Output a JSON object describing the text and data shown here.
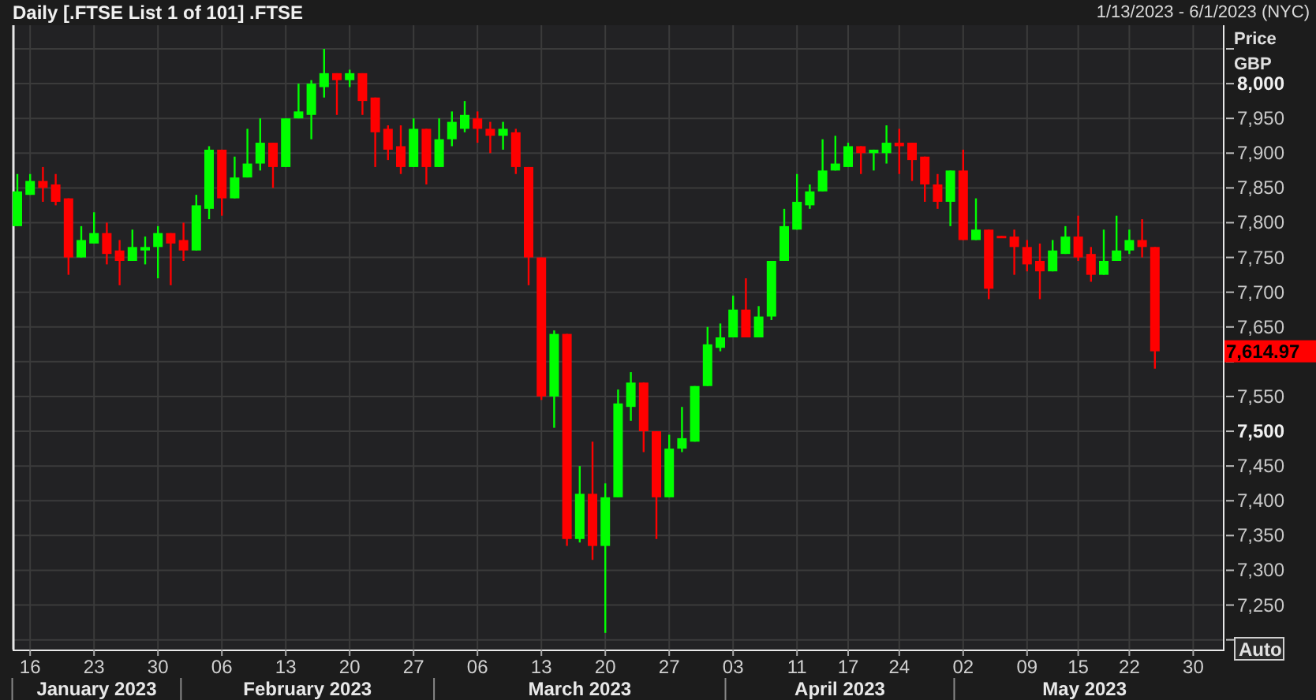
{
  "header": {
    "title": "Daily [.FTSE List 1 of 101] .FTSE",
    "date_range": "1/13/2023 - 6/1/2023 (NYC)"
  },
  "chart": {
    "currency": "GBP",
    "auto_button": "Auto",
    "months": [
      "January 2023",
      "February 2023",
      "March 2023",
      "April 2023",
      "May 2023"
    ],
    "chart_data": {
      "type": "candlestick",
      "grid": true,
      "ylabel": "Price",
      "ylim": [
        7186,
        8084
      ],
      "categories": [
        null,
        "16",
        null,
        null,
        null,
        null,
        "23",
        null,
        null,
        null,
        null,
        "30",
        null,
        null,
        null,
        null,
        "06",
        null,
        null,
        null,
        null,
        "13",
        null,
        null,
        null,
        null,
        "20",
        null,
        null,
        null,
        null,
        "27",
        null,
        null,
        null,
        null,
        "06",
        null,
        null,
        null,
        null,
        "13",
        null,
        null,
        null,
        null,
        "20",
        null,
        null,
        null,
        null,
        "27",
        null,
        null,
        null,
        null,
        "03",
        null,
        null,
        null,
        null,
        "11",
        null,
        null,
        null,
        "17",
        null,
        null,
        null,
        "24",
        null,
        null,
        null,
        null,
        "02",
        null,
        null,
        null,
        null,
        "09",
        null,
        null,
        null,
        "15",
        null,
        null,
        null,
        "22",
        null,
        null,
        null,
        null,
        "30"
      ],
      "yticks": [
        {
          "value": 8000,
          "label": "8,000"
        },
        {
          "value": 7950,
          "label": "7,950"
        },
        {
          "value": 7900,
          "label": "7,900"
        },
        {
          "value": 7850,
          "label": "7,850"
        },
        {
          "value": 7800,
          "label": "7,800"
        },
        {
          "value": 7750,
          "label": "7,750"
        },
        {
          "value": 7700,
          "label": "7,700"
        },
        {
          "value": 7650,
          "label": "7,650"
        },
        {
          "value": 7550,
          "label": "7,550"
        },
        {
          "value": 7500,
          "label": "7,500"
        },
        {
          "value": 7450,
          "label": "7,450"
        },
        {
          "value": 7400,
          "label": "7,400"
        },
        {
          "value": 7350,
          "label": "7,350"
        },
        {
          "value": 7300,
          "label": "7,300"
        },
        {
          "value": 7250,
          "label": "7,250"
        }
      ],
      "annotations": [
        "7,614.97"
      ],
      "ohlc": [
        [
          7795,
          7870,
          7795,
          7845
        ],
        [
          7840,
          7870,
          7840,
          7860
        ],
        [
          7860,
          7880,
          7830,
          7850
        ],
        [
          7855,
          7870,
          7825,
          7830
        ],
        [
          7835,
          7835,
          7725,
          7750
        ],
        [
          7750,
          7795,
          7750,
          7775
        ],
        [
          7770,
          7815,
          7770,
          7785
        ],
        [
          7785,
          7800,
          7740,
          7755
        ],
        [
          7760,
          7775,
          7710,
          7745
        ],
        [
          7745,
          7790,
          7745,
          7765
        ],
        [
          7760,
          7780,
          7740,
          7765
        ],
        [
          7765,
          7795,
          7720,
          7785
        ],
        [
          7785,
          7785,
          7710,
          7770
        ],
        [
          7775,
          7800,
          7745,
          7760
        ],
        [
          7760,
          7840,
          7760,
          7825
        ],
        [
          7820,
          7910,
          7805,
          7905
        ],
        [
          7905,
          7905,
          7810,
          7835
        ],
        [
          7835,
          7895,
          7835,
          7865
        ],
        [
          7865,
          7935,
          7865,
          7885
        ],
        [
          7885,
          7950,
          7875,
          7915
        ],
        [
          7915,
          7915,
          7850,
          7880
        ],
        [
          7880,
          7950,
          7880,
          7950
        ],
        [
          7950,
          8000,
          7950,
          7960
        ],
        [
          7955,
          8005,
          7920,
          8000
        ],
        [
          7995,
          8050,
          7980,
          8015
        ],
        [
          8015,
          8015,
          7955,
          8005
        ],
        [
          8005,
          8020,
          7995,
          8015
        ],
        [
          8015,
          8015,
          7955,
          7975
        ],
        [
          7980,
          7980,
          7880,
          7930
        ],
        [
          7935,
          7940,
          7890,
          7905
        ],
        [
          7910,
          7940,
          7870,
          7880
        ],
        [
          7880,
          7950,
          7880,
          7935
        ],
        [
          7935,
          7935,
          7855,
          7880
        ],
        [
          7880,
          7950,
          7880,
          7920
        ],
        [
          7920,
          7960,
          7910,
          7945
        ],
        [
          7935,
          7975,
          7930,
          7955
        ],
        [
          7950,
          7960,
          7915,
          7935
        ],
        [
          7935,
          7945,
          7900,
          7925
        ],
        [
          7925,
          7945,
          7905,
          7935
        ],
        [
          7930,
          7935,
          7870,
          7880
        ],
        [
          7880,
          7880,
          7710,
          7750
        ],
        [
          7750,
          7750,
          7545,
          7550
        ],
        [
          7550,
          7645,
          7505,
          7640
        ],
        [
          7640,
          7640,
          7335,
          7345
        ],
        [
          7345,
          7450,
          7340,
          7410
        ],
        [
          7410,
          7485,
          7315,
          7335
        ],
        [
          7335,
          7425,
          7210,
          7405
        ],
        [
          7405,
          7560,
          7405,
          7540
        ],
        [
          7535,
          7585,
          7515,
          7570
        ],
        [
          7570,
          7570,
          7470,
          7500
        ],
        [
          7500,
          7500,
          7345,
          7405
        ],
        [
          7405,
          7495,
          7405,
          7475
        ],
        [
          7475,
          7535,
          7470,
          7490
        ],
        [
          7485,
          7565,
          7485,
          7565
        ],
        [
          7565,
          7650,
          7565,
          7625
        ],
        [
          7620,
          7655,
          7615,
          7635
        ],
        [
          7635,
          7695,
          7635,
          7675
        ],
        [
          7675,
          7720,
          7635,
          7635
        ],
        [
          7635,
          7680,
          7635,
          7665
        ],
        [
          7665,
          7745,
          7660,
          7745
        ],
        [
          7745,
          7820,
          7745,
          7795
        ],
        [
          7790,
          7870,
          7790,
          7830
        ],
        [
          7825,
          7855,
          7820,
          7845
        ],
        [
          7845,
          7920,
          7845,
          7875
        ],
        [
          7875,
          7925,
          7875,
          7885
        ],
        [
          7880,
          7915,
          7880,
          7910
        ],
        [
          7910,
          7910,
          7870,
          7900
        ],
        [
          7900,
          7905,
          7875,
          7905
        ],
        [
          7900,
          7940,
          7885,
          7915
        ],
        [
          7915,
          7935,
          7870,
          7910
        ],
        [
          7915,
          7915,
          7860,
          7890
        ],
        [
          7895,
          7895,
          7830,
          7855
        ],
        [
          7855,
          7870,
          7820,
          7830
        ],
        [
          7830,
          7875,
          7795,
          7875
        ],
        [
          7875,
          7905,
          7775,
          7775
        ],
        [
          7775,
          7835,
          7775,
          7790
        ],
        [
          7790,
          7790,
          7690,
          7705
        ],
        [
          7781,
          7781,
          7779,
          7779
        ],
        [
          7780,
          7790,
          7725,
          7765
        ],
        [
          7765,
          7775,
          7730,
          7740
        ],
        [
          7745,
          7770,
          7690,
          7730
        ],
        [
          7730,
          7775,
          7730,
          7760
        ],
        [
          7755,
          7795,
          7755,
          7780
        ],
        [
          7780,
          7810,
          7745,
          7750
        ],
        [
          7755,
          7765,
          7715,
          7725
        ],
        [
          7725,
          7790,
          7725,
          7745
        ],
        [
          7745,
          7810,
          7745,
          7760
        ],
        [
          7760,
          7790,
          7755,
          7775
        ],
        [
          7775,
          7805,
          7750,
          7765
        ],
        [
          7765,
          7765,
          7590,
          7615
        ],
        null,
        null,
        null
      ]
    }
  }
}
